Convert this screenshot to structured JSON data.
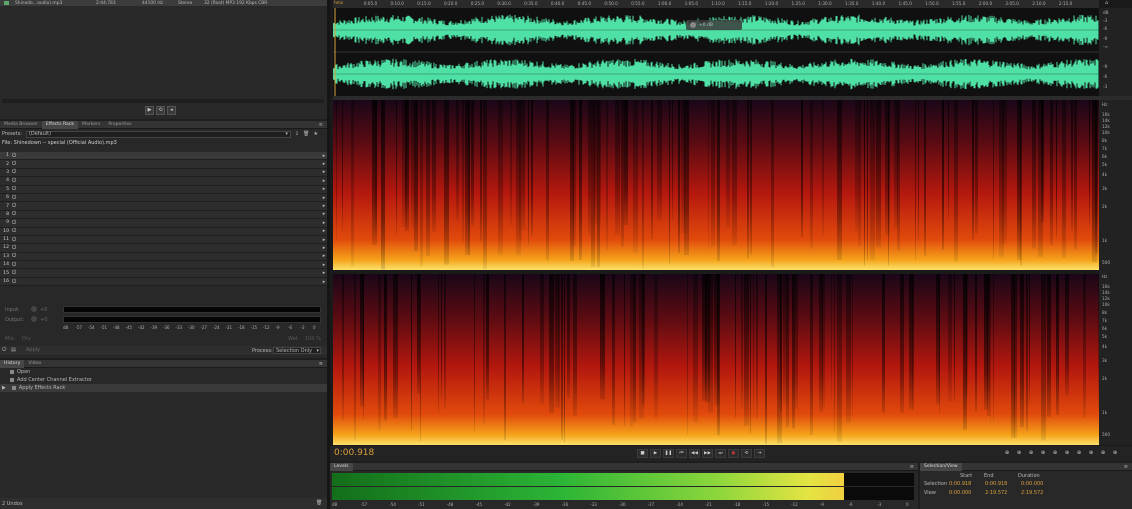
{
  "file_list": {
    "filename": "Shinedo…audio).mp3",
    "duration": "2:44.783",
    "samplerate": "44100 Hz",
    "channels": "Stereo",
    "format": "32 (float)   MP3 192 Kbps CBR"
  },
  "panel_tabs": [
    "Media Browser",
    "Effects Rack",
    "Markers",
    "Properties"
  ],
  "effects_rack": {
    "presets_label": "Presets:",
    "presets_value": "(Default)",
    "file_label": "File: Shinedown -- special (Official Audio).mp3",
    "slots": [
      "1",
      "2",
      "3",
      "4",
      "5",
      "6",
      "7",
      "8",
      "9",
      "10",
      "11",
      "12",
      "13",
      "14",
      "15",
      "16"
    ],
    "input_label": "Input:",
    "output_label": "Output:",
    "input_db": "+0",
    "output_db": "+0",
    "meter_ticks": [
      "dB",
      "-57",
      "-54",
      "-51",
      "-48",
      "-45",
      "-42",
      "-39",
      "-36",
      "-33",
      "-30",
      "-27",
      "-24",
      "-21",
      "-18",
      "-15",
      "-12",
      "-9",
      "-6",
      "-3",
      "0"
    ],
    "mix_label": "Mix:",
    "dry": "Dry",
    "wet": "Wet",
    "mix_value": "100 %",
    "apply_label": "Apply",
    "process_label": "Process:",
    "process_value": "Selection Only"
  },
  "history": {
    "tabs": [
      "History",
      "Video"
    ],
    "items": [
      "Open",
      "Add Center Channel Extractor",
      "Apply Effects Rack"
    ],
    "footer": "2 Undos"
  },
  "ruler": {
    "start": "hms",
    "ticks": [
      "0:05.0",
      "0:10.0",
      "0:15.0",
      "0:20.0",
      "0:25.0",
      "0:30.0",
      "0:35.0",
      "0:40.0",
      "0:45.0",
      "0:50.0",
      "0:55.0",
      "1:00.0",
      "1:05.0",
      "1:10.0",
      "1:15.0",
      "1:20.0",
      "1:25.0",
      "1:30.0",
      "1:35.0",
      "1:40.0",
      "1:45.0",
      "1:50.0",
      "1:55.0",
      "2:00.0",
      "2:05.0",
      "2:10.0",
      "2:15.0"
    ]
  },
  "hud": {
    "volume": "+0 dB"
  },
  "waveform_db": [
    "dB",
    "-3",
    "-6",
    "-9",
    "-∞",
    "-9",
    "-6",
    "-3"
  ],
  "spectrogram_hz": [
    "Hz",
    "16k",
    "14k",
    "12k",
    "10k",
    "8k",
    "7k",
    "6k",
    "5k",
    "4k",
    "3k",
    "2k",
    "1k",
    "500"
  ],
  "transport": {
    "time": "0:00.918",
    "buttons": [
      "stop-icon",
      "play-icon",
      "pause-icon",
      "go-to-start-icon",
      "rewind-icon",
      "fast-forward-icon",
      "go-to-end-icon",
      "record-icon",
      "loop-icon",
      "skip-icon"
    ],
    "zoom_buttons": [
      "zoom-in-amp-icon",
      "zoom-out-amp-icon",
      "zoom-in-icon",
      "zoom-out-icon",
      "zoom-full-icon",
      "zoom-in-point-icon",
      "zoom-out-point-icon",
      "zoom-selection-icon",
      "zoom-in-vertical-icon",
      "zoom-out-vertical-icon"
    ]
  },
  "levels": {
    "title": "Levels",
    "ticks": [
      "dB",
      "-57",
      "-54",
      "-51",
      "-48",
      "-45",
      "-42",
      "-39",
      "-36",
      "-33",
      "-30",
      "-27",
      "-24",
      "-21",
      "-18",
      "-15",
      "-12",
      "-9",
      "-6",
      "-3",
      "0"
    ],
    "level_fraction": 0.88
  },
  "selection_view": {
    "title": "Selection/View",
    "col_start": "Start",
    "col_end": "End",
    "col_duration": "Duration",
    "selection_label": "Selection",
    "view_label": "View",
    "selection_start": "0:00.918",
    "selection_end": "0:00.918",
    "selection_duration": "0:00.000",
    "view_start": "0:00.000",
    "view_end": "2:19.572",
    "view_duration": "2:19.572"
  },
  "colors": {
    "waveform": "#4fe0a5",
    "accent": "#d9a03c",
    "panel": "#282828"
  }
}
